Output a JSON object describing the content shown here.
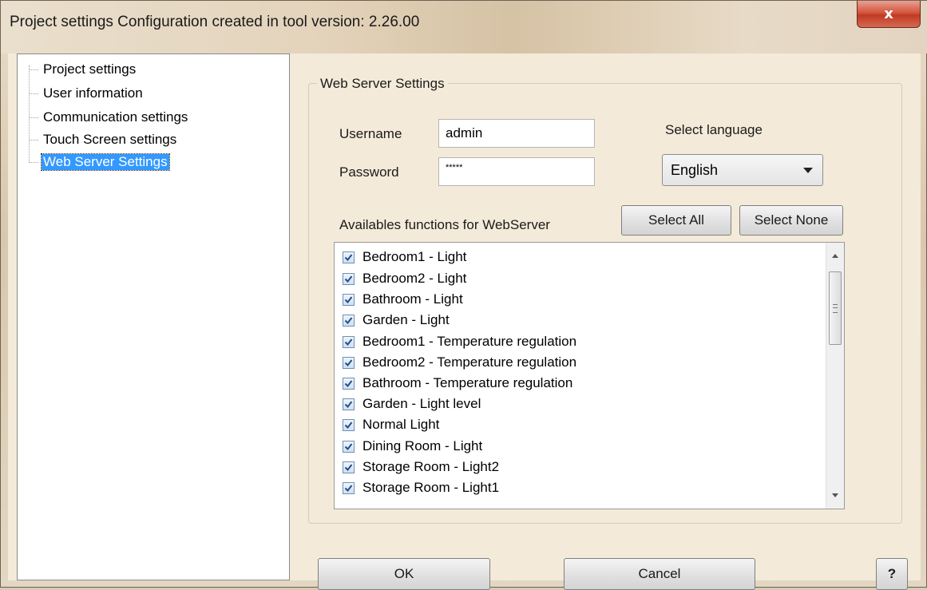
{
  "window": {
    "title": "Project  settings  Configuration created in tool version:  2.26.00",
    "close_label": "x"
  },
  "tree": {
    "items": [
      {
        "label": "Project  settings"
      },
      {
        "label": "User information"
      },
      {
        "label": "Communication settings"
      },
      {
        "label": "Touch Screen settings"
      },
      {
        "label": "Web Server Settings",
        "selected": true
      }
    ]
  },
  "web_server": {
    "group_title": "Web Server Settings",
    "username_label": "Username",
    "username_value": "admin",
    "password_label": "Password",
    "password_value": "*****",
    "language_label": "Select language",
    "language_value": "English",
    "functions_label": "Availables functions for WebServer",
    "select_all_label": "Select All",
    "select_none_label": "Select None",
    "functions": [
      {
        "label": "Bedroom1 - Light",
        "checked": true
      },
      {
        "label": "Bedroom2 - Light",
        "checked": true
      },
      {
        "label": "Bathroom - Light",
        "checked": true
      },
      {
        "label": "Garden - Light",
        "checked": true
      },
      {
        "label": "Bedroom1 - Temperature regulation",
        "checked": true
      },
      {
        "label": "Bedroom2 - Temperature regulation",
        "checked": true
      },
      {
        "label": "Bathroom - Temperature regulation",
        "checked": true
      },
      {
        "label": "Garden - Light level",
        "checked": true
      },
      {
        "label": "Normal Light",
        "checked": true
      },
      {
        "label": "Dining Room - Light",
        "checked": true
      },
      {
        "label": "Storage Room - Light2",
        "checked": true
      },
      {
        "label": "Storage Room - Light1",
        "checked": true
      }
    ]
  },
  "footer": {
    "ok_label": "OK",
    "cancel_label": "Cancel",
    "help_label": "?"
  },
  "colors": {
    "selection": "#3399ff",
    "close_button": "#c13a22"
  }
}
